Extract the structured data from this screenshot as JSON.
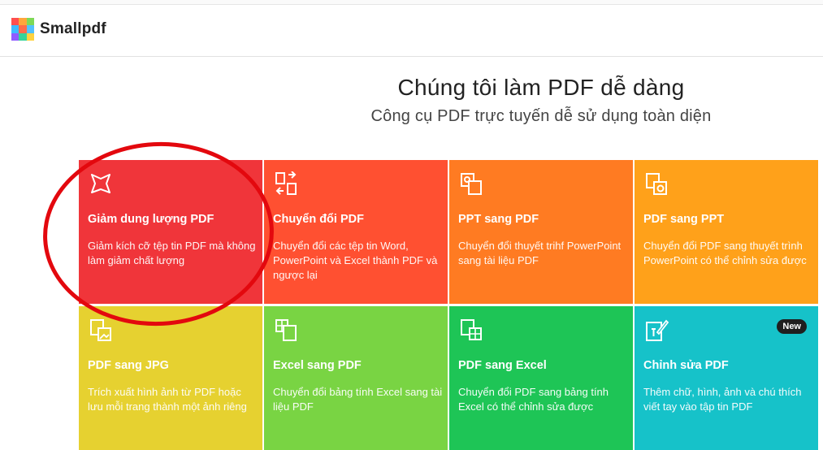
{
  "brand": {
    "name": "Smallpdf",
    "logo_colors": [
      "#ff4f4f",
      "#ffa63b",
      "#7ed957",
      "#3dbbff",
      "#ff6b4a",
      "#52c2ff",
      "#8f5cff",
      "#35d39b",
      "#ffd23f"
    ]
  },
  "hero": {
    "title": "Chúng tôi làm PDF dễ dàng",
    "subtitle": "Công cụ PDF trực tuyến dễ sử dụng toàn diện"
  },
  "tools": [
    {
      "title": "Giảm dung lượng PDF",
      "desc": "Giảm kích cỡ tệp tin PDF mà không làm giảm chất lượng",
      "color": "#f0353a",
      "icon": "compress-icon"
    },
    {
      "title": "Chuyển đổi PDF",
      "desc": "Chuyển đổi các tệp tin Word, PowerPoint và Excel thành PDF và ngược lại",
      "color": "#ff5031",
      "icon": "convert-icon"
    },
    {
      "title": "PPT sang PDF",
      "desc": "Chuyển đổi thuyết trihf PowerPoint sang tài liệu PDF",
      "color": "#ff7b22",
      "icon": "ppt-to-pdf-icon"
    },
    {
      "title": "PDF sang PPT",
      "desc": "Chuyển đổi PDF sang thuyết trình PowerPoint có thể chỉnh sửa được",
      "color": "#ffa11a",
      "icon": "pdf-to-ppt-icon"
    },
    {
      "title": "PDF sang JPG",
      "desc": "Trích xuất hình ảnh từ PDF hoặc lưu mỗi trang thành một ảnh riêng",
      "color": "#e6d130",
      "icon": "pdf-to-jpg-icon"
    },
    {
      "title": "Excel sang PDF",
      "desc": "Chuyển đổi bảng tính Excel sang tài liệu PDF",
      "color": "#79d443",
      "icon": "excel-to-pdf-icon"
    },
    {
      "title": "PDF sang Excel",
      "desc": "Chuyển đổi PDF sang bảng tính Excel có thể chỉnh sửa được",
      "color": "#1ec556",
      "icon": "pdf-to-excel-icon"
    },
    {
      "title": "Chỉnh sửa PDF",
      "desc": "Thêm chữ, hình, ảnh và chú thích viết tay vào tập tin PDF",
      "color": "#16c2c9",
      "icon": "edit-pdf-icon",
      "badge": "New"
    }
  ],
  "annotation": {
    "color": "#e3080e"
  }
}
